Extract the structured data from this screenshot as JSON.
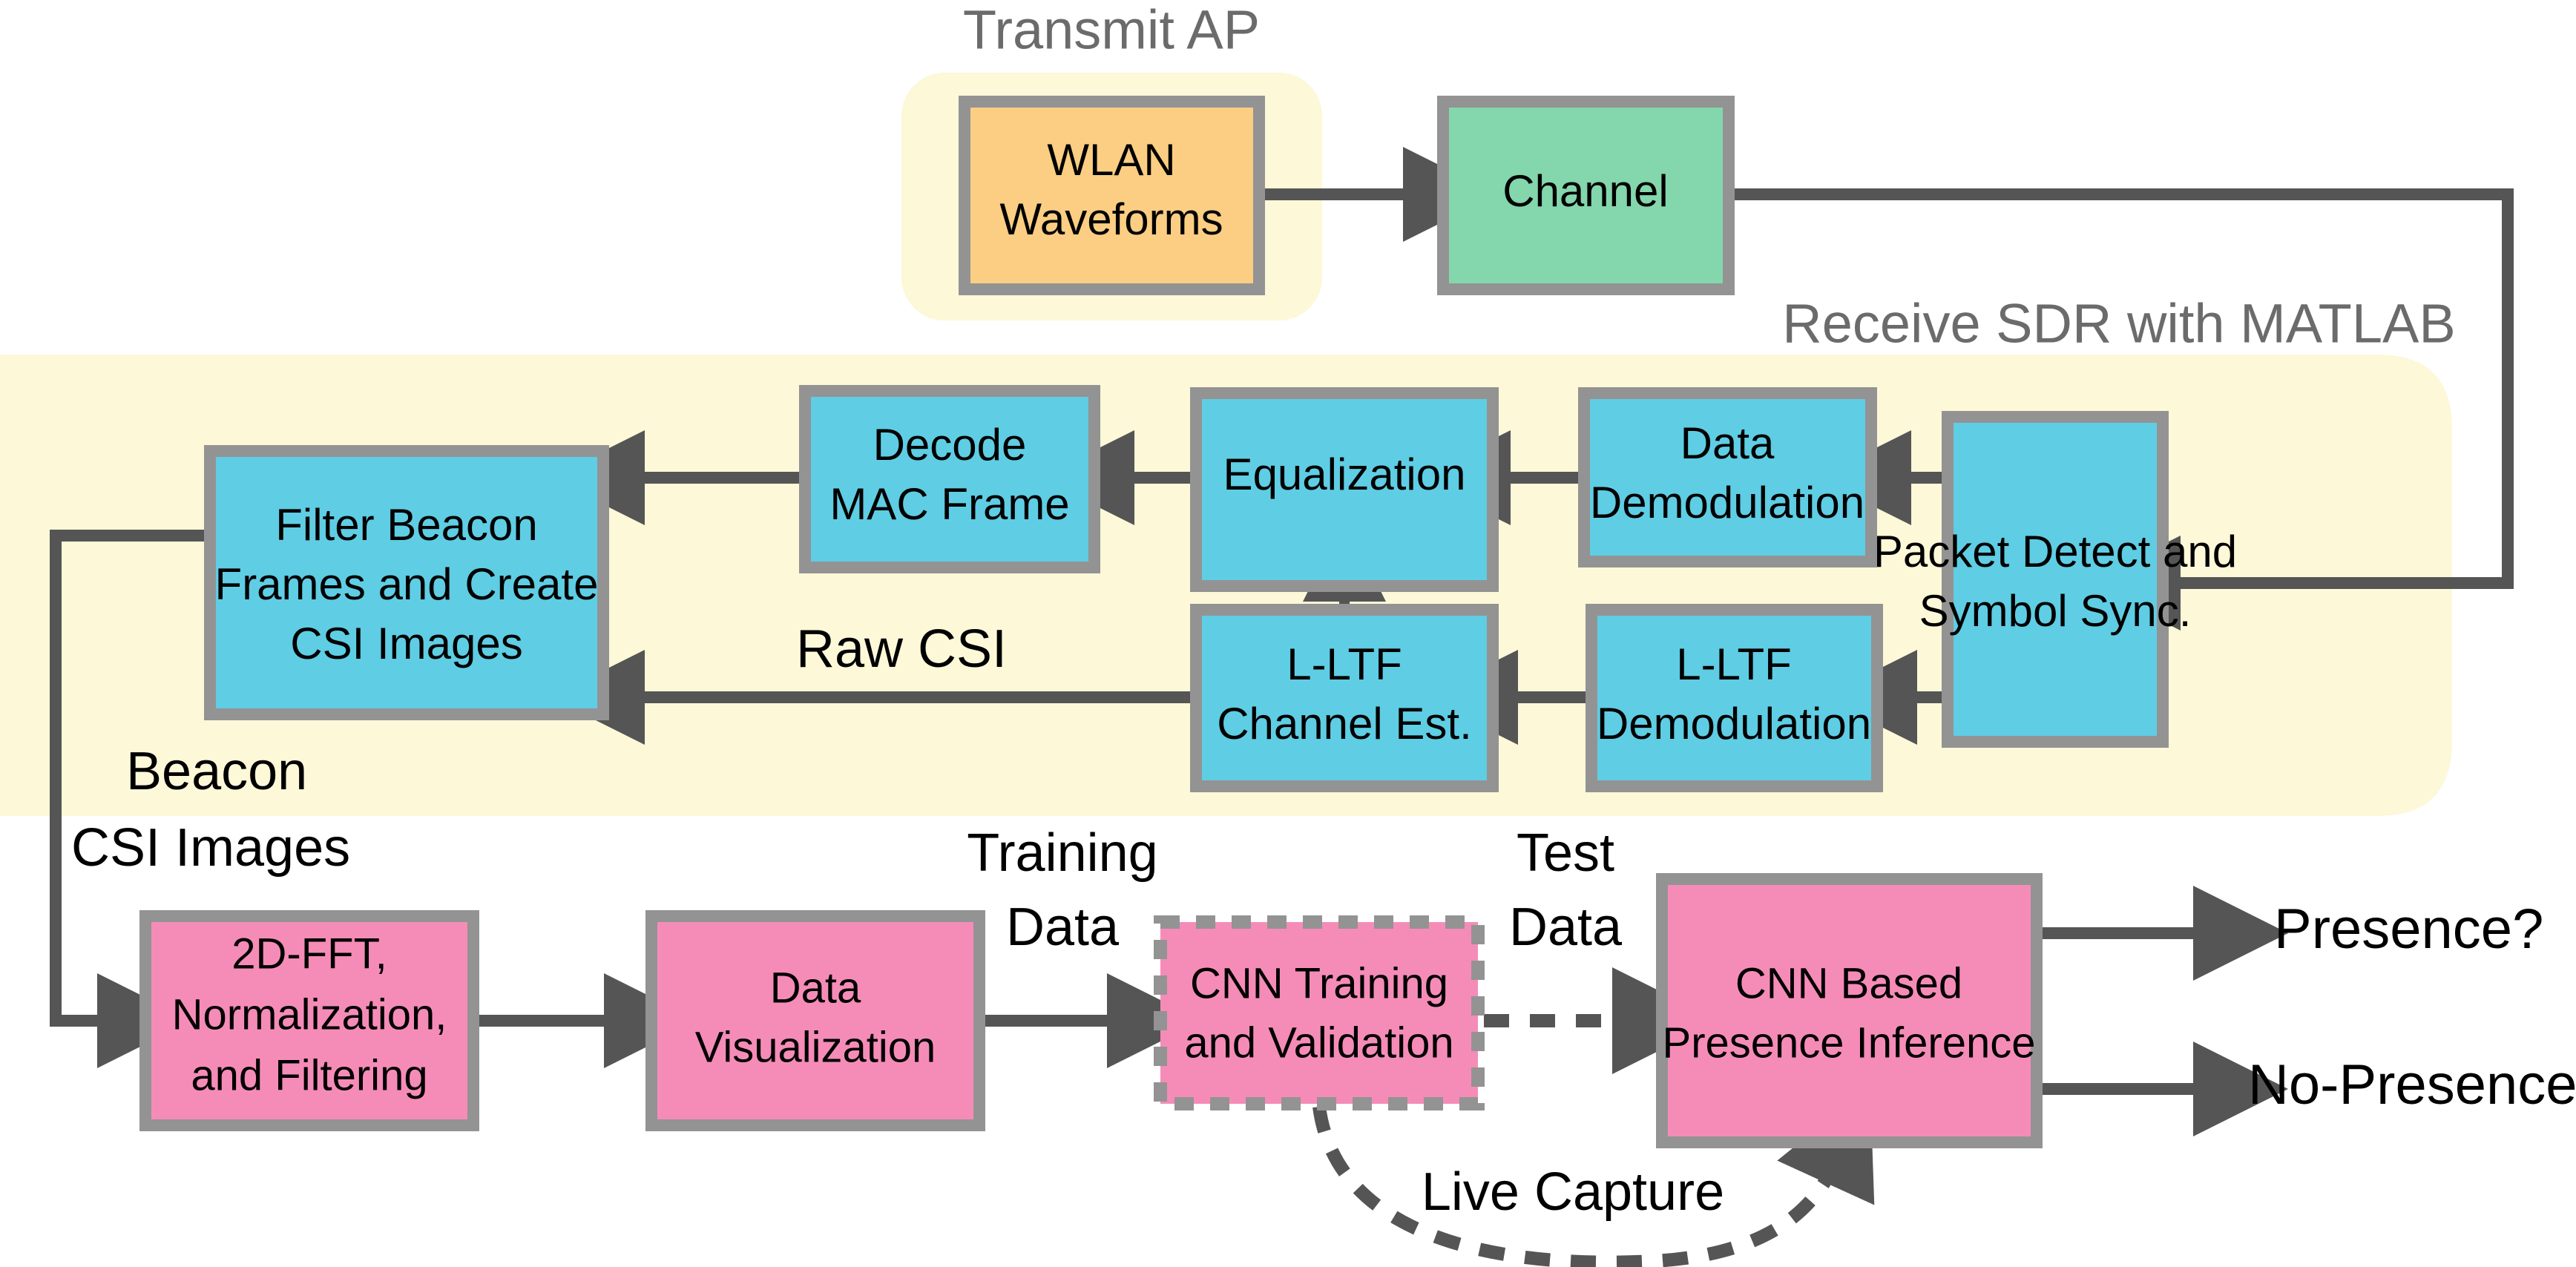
{
  "diagram": {
    "title_transmit": "Transmit AP",
    "title_receive": "Receive SDR with MATLAB",
    "colors": {
      "panel_yellow": "#FCF8D8",
      "box_cyan": "#5FCDE4",
      "box_orange": "#FBCE83",
      "box_green": "#84D6AC",
      "box_pink": "#F58CB8",
      "box_border": "#939393",
      "arrow": "#555555",
      "group_title": "#6b6b6b",
      "text": "#000000",
      "background": "#FFFFFF"
    },
    "boxes": {
      "wlan_waveforms": "WLAN\nWaveforms",
      "wlan_line1": "WLAN",
      "wlan_line2": "Waveforms",
      "channel": "Channel",
      "packet_detect_line1": "Packet Detect and",
      "packet_detect_line2": "Symbol Sync.",
      "data_demodulation_line1": "Data",
      "data_demodulation_line2": "Demodulation",
      "equalization": "Equalization",
      "decode_mac_line1": "Decode",
      "decode_mac_line2": "MAC Frame",
      "filter_beacon_line1": "Filter Beacon",
      "filter_beacon_line2": "Frames and Create",
      "filter_beacon_line3": "CSI Images",
      "lltf_demodulation_line1": "L-LTF",
      "lltf_demodulation_line2": "Demodulation",
      "lltf_channel_est_line1": "L-LTF",
      "lltf_channel_est_line2": "Channel Est.",
      "fft_line1": "2D-FFT,",
      "fft_line2": "Normalization,",
      "fft_line3": "and Filtering",
      "data_visualization_line1": "Data",
      "data_visualization_line2": "Visualization",
      "cnn_training_line1": "CNN Training",
      "cnn_training_line2": "and Validation",
      "cnn_inference_line1": "CNN Based",
      "cnn_inference_line2": "Presence Inference"
    },
    "edge_labels": {
      "raw_csi": "Raw CSI",
      "beacon_line1": "Beacon",
      "beacon_line2": "CSI Images",
      "training_line1": "Training",
      "training_line2": "Data",
      "test_line1": "Test",
      "test_line2": "Data",
      "live_capture": "Live Capture"
    },
    "outputs": {
      "presence": "Presence?",
      "no_presence": "No-Presence?"
    }
  }
}
